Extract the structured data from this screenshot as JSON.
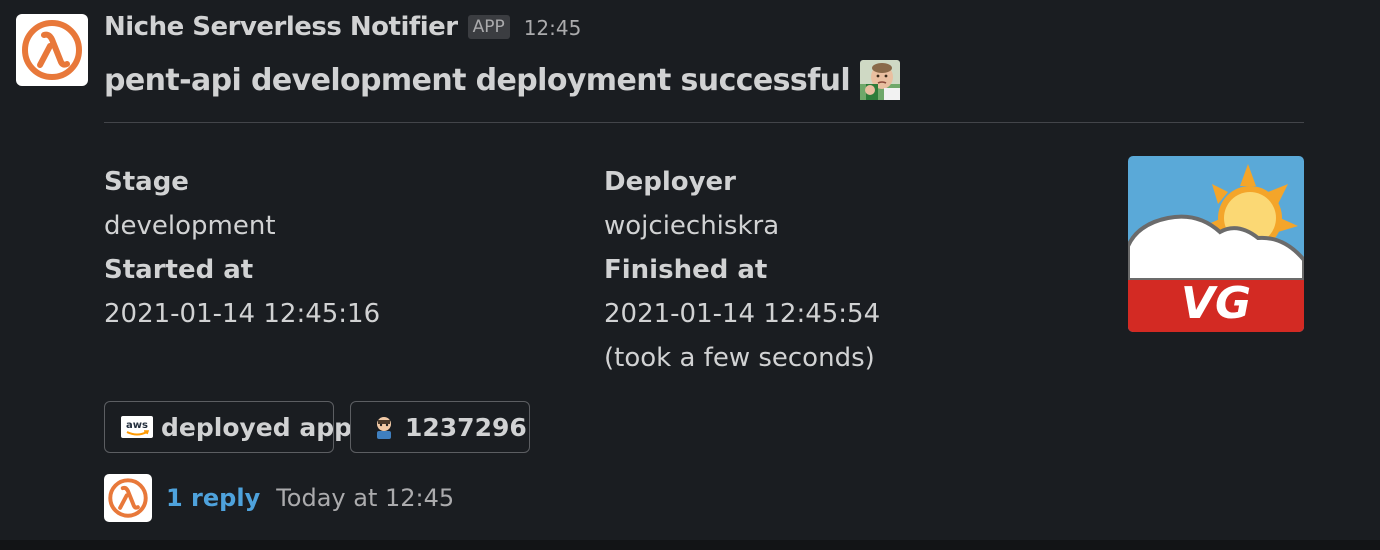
{
  "message": {
    "app_name": "Niche Serverless Notifier",
    "app_badge": "APP",
    "time": "12:45",
    "headline": "pent-api development deployment successful",
    "emoji": "success-kid-emoji"
  },
  "fields": {
    "stage_label": "Stage",
    "stage_value": "development",
    "started_label": "Started at",
    "started_value": "2021-01-14 12:45:16",
    "deployer_label": "Deployer",
    "deployer_value": "wojciechiskra",
    "finished_label": "Finished at",
    "finished_value": "2021-01-14 12:45:54",
    "duration_note": "(took a few seconds)"
  },
  "thumbnail": {
    "text": "VG",
    "icon": "vg-weather-logo"
  },
  "buttons": {
    "aws_label": "deployed app",
    "aws_icon": "aws-icon",
    "run_label": "1237296",
    "run_icon": "github-actions-octocat-icon"
  },
  "thread": {
    "reply_count_label": "1 reply",
    "reply_time": "Today at 12:45"
  },
  "colors": {
    "background": "#1a1d21",
    "text": "#d1d2d3",
    "muted": "#ababad",
    "link": "#4ea2dc",
    "lambda_orange": "#e8783a",
    "vg_red": "#d32a23",
    "vg_sky": "#5aa9d8"
  }
}
